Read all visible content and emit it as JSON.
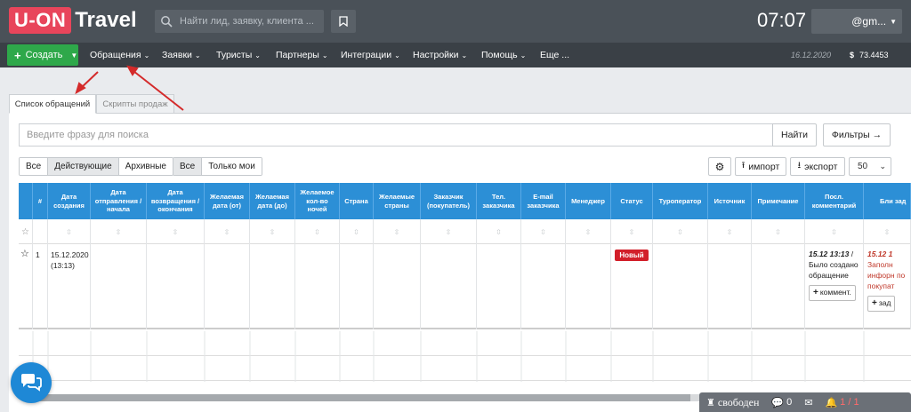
{
  "header": {
    "logo_box": "U-ON",
    "logo_rest": "Travel",
    "search_placeholder": "Найти лид, заявку, клиента ...",
    "clock": "07:07",
    "user": "@gm..."
  },
  "nav": {
    "create": "Создать",
    "items": [
      "Обращения",
      "Заявки",
      "Туристы",
      "Партнеры",
      "Интеграции",
      "Настройки",
      "Помощь",
      "Еще ..."
    ],
    "date": "16.12.2020",
    "currency": "$",
    "rate": "73.4453"
  },
  "tabs": [
    "Список обращений",
    "Скрипты продаж"
  ],
  "search": {
    "placeholder": "Введите фразу для поиска",
    "find": "Найти",
    "filters": "Фильтры →"
  },
  "filters": {
    "state": [
      "Все",
      "Действующие",
      "Архивные"
    ],
    "state_selected": "Действующие",
    "owner": [
      "Все",
      "Только мои"
    ],
    "owner_selected": "Все"
  },
  "toolbar": {
    "import": "импорт",
    "export": "экспорт",
    "per_page": "50"
  },
  "table": {
    "columns": [
      "",
      "#",
      "Дата создания",
      "Дата отправления / начала",
      "Дата возвращения / окончания",
      "Желаемая дата (от)",
      "Желаемая дата (до)",
      "Желаемое кол-во ночей",
      "Страна",
      "Желаемые страны",
      "Заказчик (покупатель)",
      "Тел. заказчика",
      "E-mail заказчика",
      "Менеджер",
      "Статус",
      "Туроператор",
      "Источник",
      "Примечание",
      "Посл. комментарий",
      "Бли зад"
    ],
    "row": {
      "num": "1",
      "created": "15.12.2020",
      "created_time": "(13:13)",
      "status": "Новый",
      "comment_time": "15.12 13:13",
      "comment_text": "Было создано обращение",
      "comment_btn": "коммент.",
      "task_time": "15.12 1",
      "task_text": "Заполн инфорн по покупат",
      "task_btn": "зад"
    }
  },
  "statusbar": {
    "state": "свободен",
    "chats": "0",
    "alerts": "1 / 1"
  }
}
